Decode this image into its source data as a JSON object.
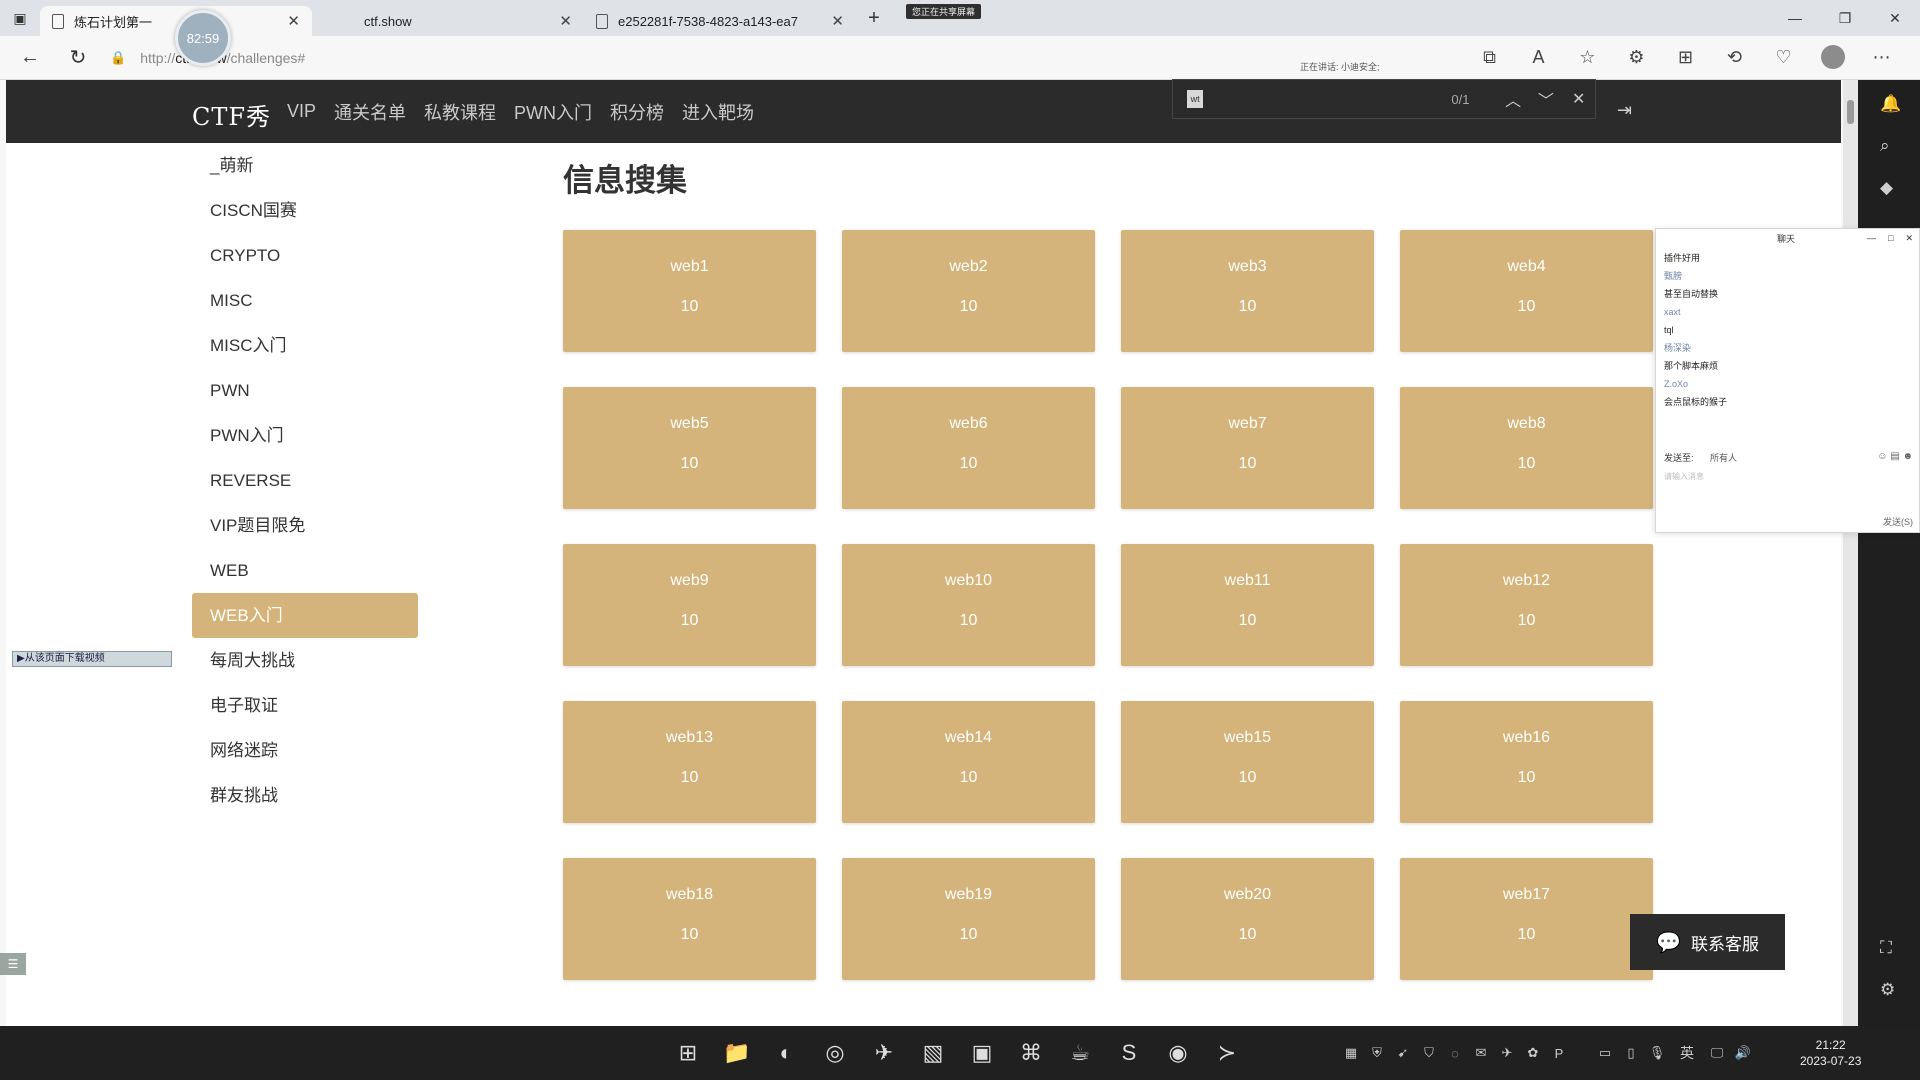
{
  "timer": "82:59",
  "tabs": [
    {
      "title": "炼石计划第一",
      "active": true
    },
    {
      "title": "ctf.show",
      "active": false
    },
    {
      "title": "e252281f-7538-4823-a143-ea7",
      "active": false
    }
  ],
  "share_badge": "您正在共享屏幕",
  "address": {
    "proto": "http",
    "host": "ctf.show",
    "path": "/challenges#"
  },
  "speaker_note": "正在讲话: 小迪安全;",
  "find": {
    "count": "0/1"
  },
  "site": {
    "logo": "CTF秀",
    "nav": [
      "VIP",
      "通关名单",
      "私教课程",
      "PWN入门",
      "积分榜",
      "进入靶场"
    ]
  },
  "sidebar": {
    "items": [
      "_萌新",
      "CISCN国赛",
      "CRYPTO",
      "MISC",
      "MISC入门",
      "PWN",
      "PWN入门",
      "REVERSE",
      "VIP题目限免",
      "WEB",
      "WEB入门",
      "每周大挑战",
      "电子取证",
      "网络迷踪",
      "群友挑战"
    ],
    "active": "WEB入门"
  },
  "section_title": "信息搜集",
  "challenges": [
    {
      "name": "web1",
      "score": "10"
    },
    {
      "name": "web2",
      "score": "10"
    },
    {
      "name": "web3",
      "score": "10"
    },
    {
      "name": "web4",
      "score": "10"
    },
    {
      "name": "web5",
      "score": "10"
    },
    {
      "name": "web6",
      "score": "10"
    },
    {
      "name": "web7",
      "score": "10"
    },
    {
      "name": "web8",
      "score": "10"
    },
    {
      "name": "web9",
      "score": "10"
    },
    {
      "name": "web10",
      "score": "10"
    },
    {
      "name": "web11",
      "score": "10"
    },
    {
      "name": "web12",
      "score": "10"
    },
    {
      "name": "web13",
      "score": "10"
    },
    {
      "name": "web14",
      "score": "10"
    },
    {
      "name": "web15",
      "score": "10"
    },
    {
      "name": "web16",
      "score": "10"
    },
    {
      "name": "web18",
      "score": "10"
    },
    {
      "name": "web19",
      "score": "10"
    },
    {
      "name": "web20",
      "score": "10"
    },
    {
      "name": "web17",
      "score": "10"
    }
  ],
  "download_bar": "▶从该页面下载视频",
  "service_button": "联系客服",
  "chat": {
    "title": "聊天",
    "lines": [
      {
        "text": "插件好用",
        "sender": false
      },
      {
        "text": "甄膀",
        "sender": true
      },
      {
        "text": "甚至自动替换",
        "sender": false
      },
      {
        "text": "xaxt",
        "sender": true
      },
      {
        "text": "tql",
        "sender": false
      },
      {
        "text": "杨深染",
        "sender": true
      },
      {
        "text": "那个脚本麻烦",
        "sender": false
      },
      {
        "text": "Z.oXo",
        "sender": true
      },
      {
        "text": "会点鼠标的猴子",
        "sender": false
      }
    ],
    "send_to_label": "发送至:",
    "send_to_value": "所有人",
    "input_placeholder": "请输入消息",
    "send_button": "发送(S)"
  },
  "taskbar": {
    "ime": "英",
    "time": "21:22",
    "date": "2023-07-23"
  },
  "colors": {
    "card": "#d4b47a",
    "header": "#2b2b2b",
    "taskbar": "#202020"
  }
}
